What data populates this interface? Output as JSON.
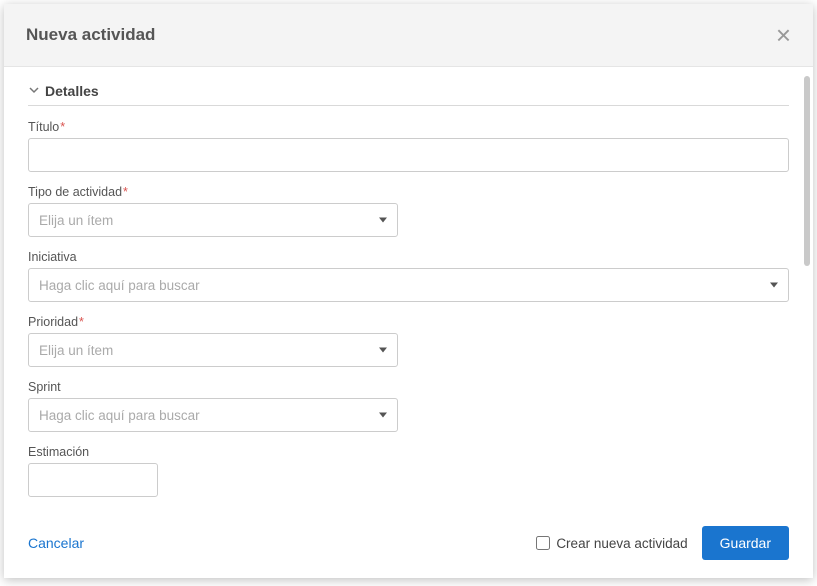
{
  "modal": {
    "title": "Nueva actividad"
  },
  "section": {
    "detalles": "Detalles"
  },
  "fields": {
    "titulo": {
      "label": "Título"
    },
    "tipo_actividad": {
      "label": "Tipo de actividad",
      "placeholder": "Elija un ítem"
    },
    "iniciativa": {
      "label": "Iniciativa",
      "placeholder": "Haga clic aquí para buscar"
    },
    "prioridad": {
      "label": "Prioridad",
      "placeholder": "Elija un ítem"
    },
    "sprint": {
      "label": "Sprint",
      "placeholder": "Haga clic aquí para buscar"
    },
    "estimacion": {
      "label": "Estimación"
    }
  },
  "footer": {
    "cancel": "Cancelar",
    "create_new": "Crear nueva actividad",
    "save": "Guardar"
  }
}
